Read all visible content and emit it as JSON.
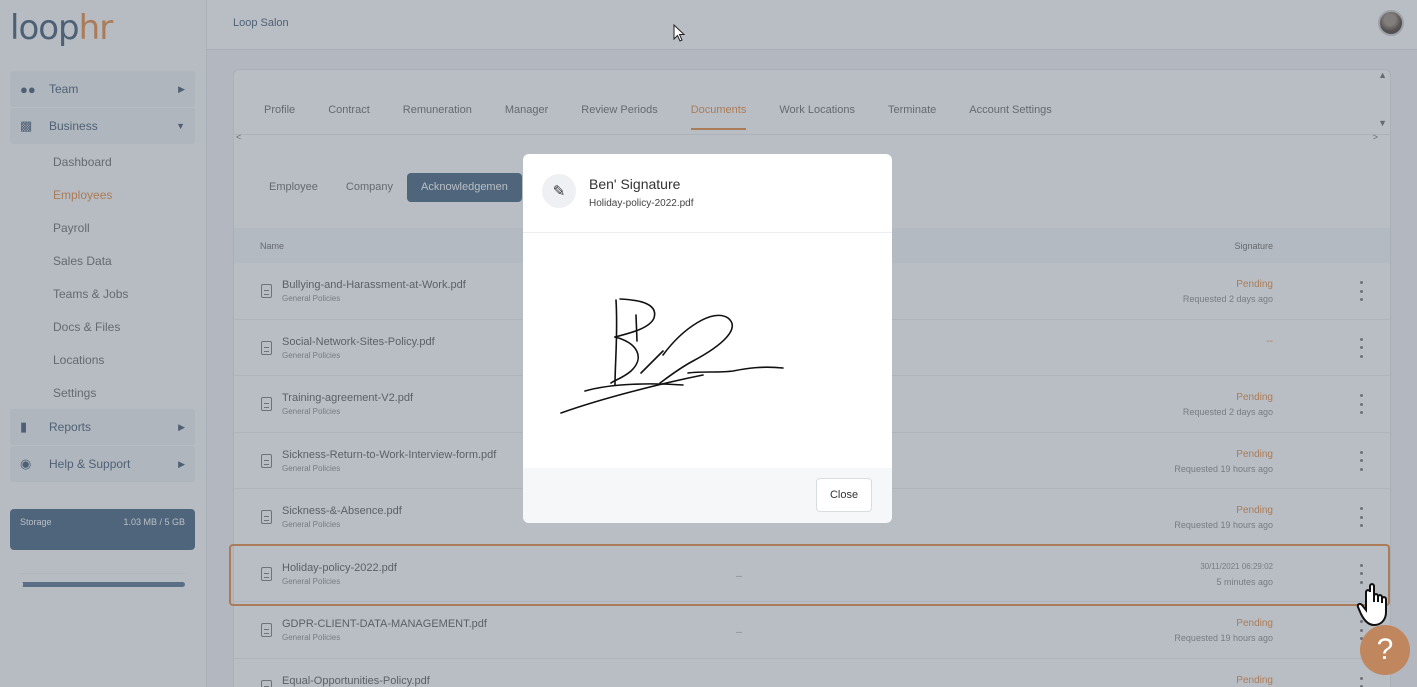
{
  "brand": {
    "logo_main": "loop",
    "logo_accent": "hr"
  },
  "topbar": {
    "company": "Loop Salon"
  },
  "sidebar": {
    "items": [
      {
        "label": "Team",
        "icon": "team-icon"
      },
      {
        "label": "Business",
        "icon": "briefcase-icon"
      }
    ],
    "business_sub": [
      "Dashboard",
      "Employees",
      "Payroll",
      "Sales Data",
      "Teams & Jobs",
      "Docs & Files",
      "Locations",
      "Settings"
    ],
    "bottom_items": [
      {
        "label": "Reports",
        "icon": "bar-chart-icon"
      },
      {
        "label": "Help & Support",
        "icon": "globe-icon"
      }
    ],
    "storage": {
      "label": "Storage",
      "value": "1.03 MB / 5 GB",
      "fraction": 0.0002
    }
  },
  "tabs": [
    "Profile",
    "Contract",
    "Remuneration",
    "Manager",
    "Review Periods",
    "Documents",
    "Work Locations",
    "Terminate",
    "Account Settings"
  ],
  "active_tab": "Documents",
  "subtabs": [
    "Employee",
    "Company",
    "Acknowledgemen"
  ],
  "active_subtab": "Acknowledgemen",
  "table": {
    "col_name": "Name",
    "col_signature": "Signature",
    "rows": [
      {
        "name": "Bullying-and-Harassment-at-Work.pdf",
        "category": "General Policies",
        "mid": "",
        "status": "Pending",
        "sub": "Requested 2 days ago"
      },
      {
        "name": "Social-Network-Sites-Policy.pdf",
        "category": "General Policies",
        "mid": "",
        "status": "--",
        "sub": ""
      },
      {
        "name": "Training-agreement-V2.pdf",
        "category": "General Policies",
        "mid": "",
        "status": "Pending",
        "sub": "Requested 2 days ago"
      },
      {
        "name": "Sickness-Return-to-Work-Interview-form.pdf",
        "category": "General Policies",
        "mid": "",
        "status": "Pending",
        "sub": "Requested 19 hours ago"
      },
      {
        "name": "Sickness-&-Absence.pdf",
        "category": "General Policies",
        "mid": "",
        "status": "Pending",
        "sub": "Requested 19 hours ago"
      },
      {
        "name": "Holiday-policy-2022.pdf",
        "category": "General Policies",
        "mid": "--",
        "status": "30/11/2021 06:29:02",
        "sub": "5 minutes ago"
      },
      {
        "name": "GDPR-CLIENT-DATA-MANAGEMENT.pdf",
        "category": "General Policies",
        "mid": "--",
        "status": "Pending",
        "sub": "Requested 19 hours ago"
      },
      {
        "name": "Equal-Opportunities-Policy.pdf",
        "category": "",
        "mid": "",
        "status": "Pending",
        "sub": ""
      }
    ]
  },
  "modal": {
    "title": "Ben' Signature",
    "subtitle": "Holiday-policy-2022.pdf",
    "close_label": "Close",
    "icon": "pencil-icon"
  },
  "help": {
    "label": "?"
  },
  "colors": {
    "accent": "#e6883d",
    "primary": "#3e5d7a"
  }
}
